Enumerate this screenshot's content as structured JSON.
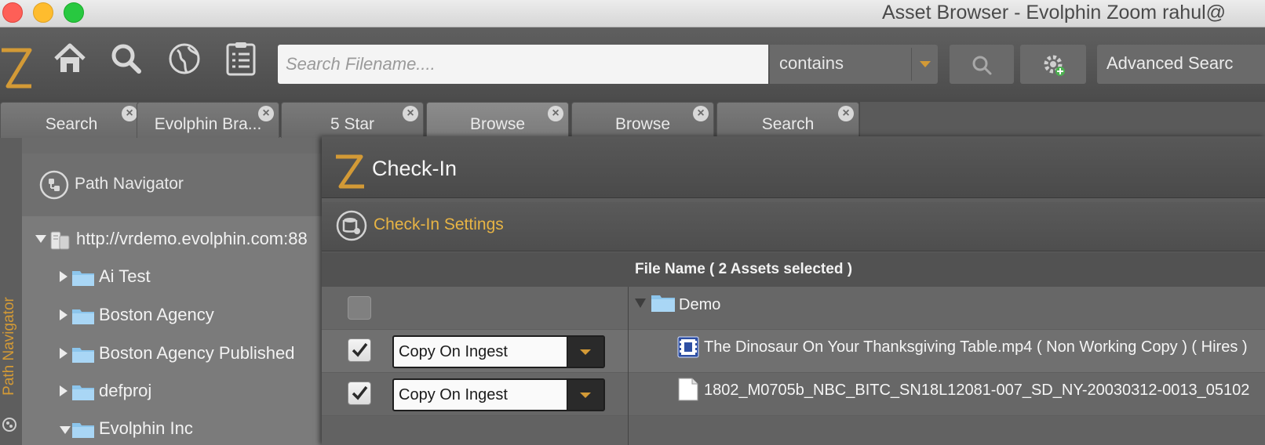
{
  "window": {
    "title": "Asset Browser - Evolphin Zoom rahul@"
  },
  "toolbar": {
    "search_placeholder": "Search Filename....",
    "match_mode": "contains",
    "advanced_search_label": "Advanced Searc"
  },
  "tabs": [
    {
      "label": "Search"
    },
    {
      "label": "Evolphin Bra..."
    },
    {
      "label": "5 Star"
    },
    {
      "label": "Browse"
    },
    {
      "label": "Browse"
    },
    {
      "label": "Search"
    }
  ],
  "sidebar": {
    "strip_label": "Path Navigator"
  },
  "path_navigator": {
    "title": "Path Navigator",
    "server": "http://vrdemo.evolphin.com:88",
    "folders": [
      {
        "label": "Ai Test"
      },
      {
        "label": "Boston Agency"
      },
      {
        "label": "Boston Agency Published"
      },
      {
        "label": "defproj"
      },
      {
        "label": "Evolphin Inc"
      }
    ]
  },
  "checkin_dialog": {
    "title": "Check-In",
    "settings_label": "Check-In Settings",
    "column_header": "File Name  ( 2 Assets selected )",
    "folder": "Demo",
    "rows": [
      {
        "option": "Copy On Ingest",
        "file": "The Dinosaur On Your Thanksgiving Table.mp4 ( Non Working Copy ) ( Hires )"
      },
      {
        "option": "Copy On Ingest",
        "file": "1802_M0705b_NBC_BITC_SN18L12081-007_SD_NY-20030312-0013_05102"
      }
    ]
  },
  "colors": {
    "accent": "#d39a36",
    "settings_text": "#e8b444"
  }
}
